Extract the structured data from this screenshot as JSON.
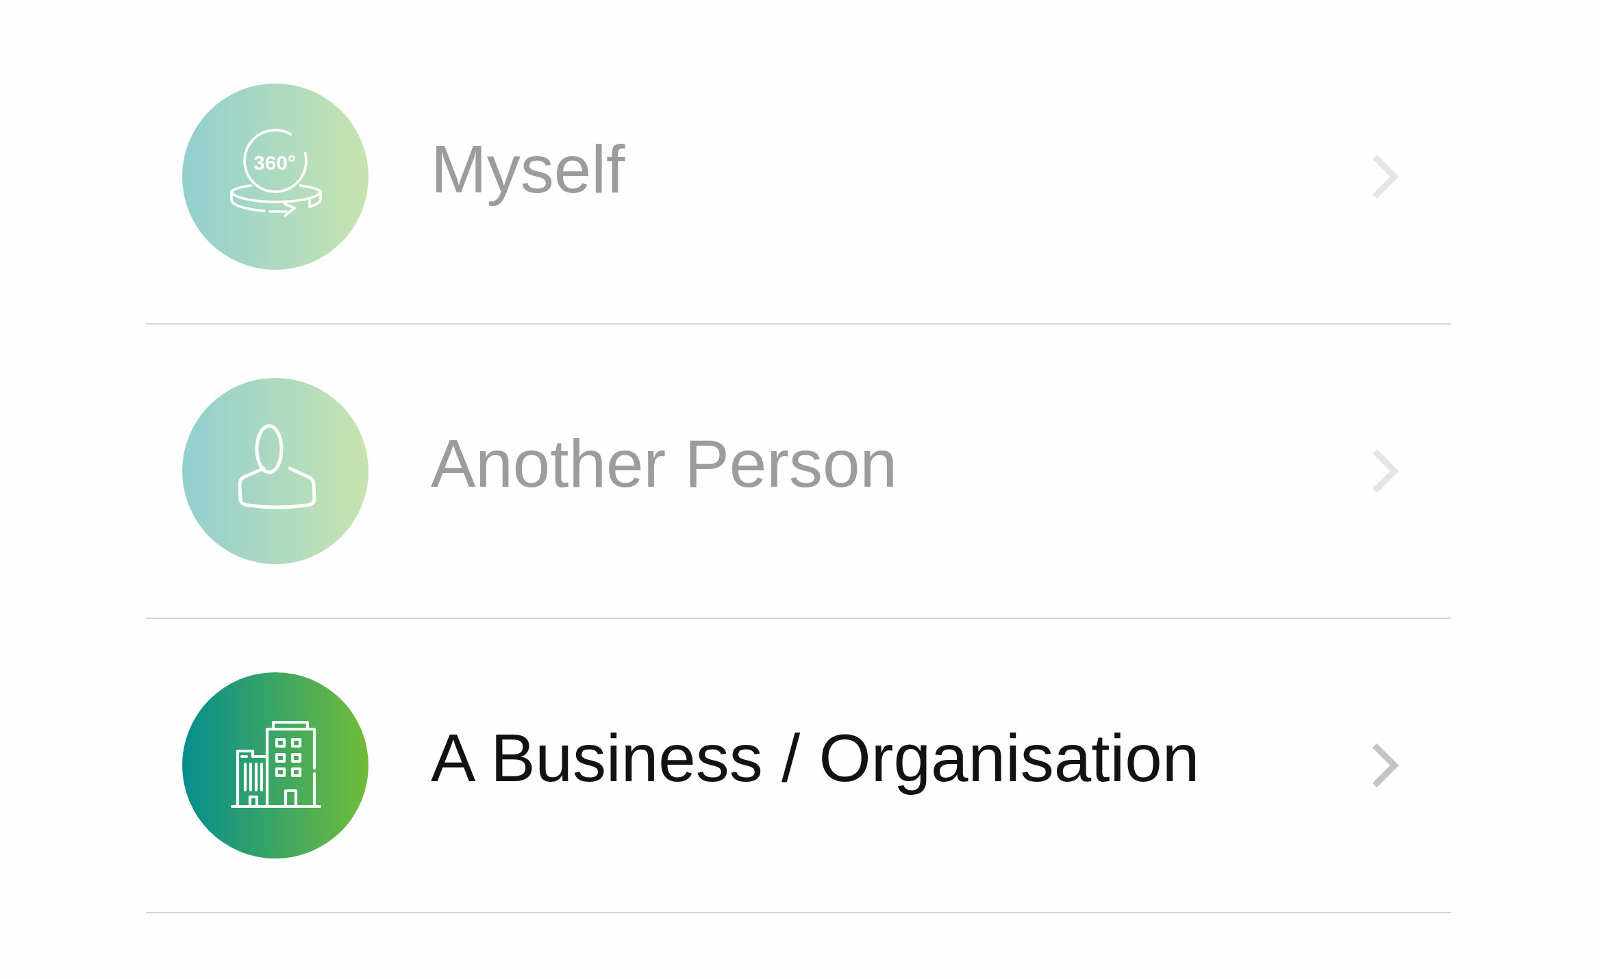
{
  "options": [
    {
      "label": "Myself",
      "icon_label": "360°",
      "selected": false
    },
    {
      "label": "Another Person",
      "selected": false
    },
    {
      "label": "A Business / Organisation",
      "selected": true
    }
  ]
}
